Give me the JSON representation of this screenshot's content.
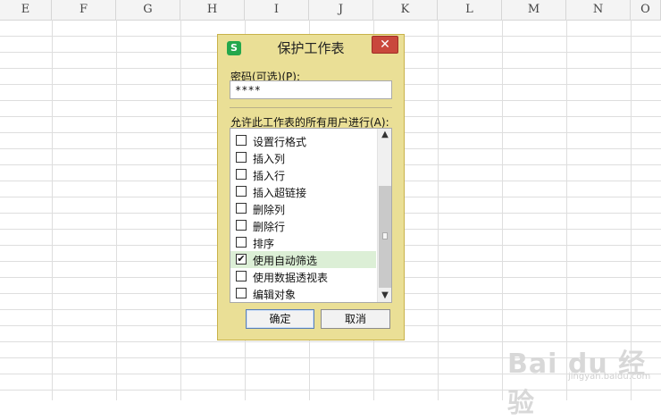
{
  "sheet": {
    "columns": [
      "E",
      "F",
      "G",
      "H",
      "I",
      "J",
      "K",
      "L",
      "M",
      "N",
      "O"
    ]
  },
  "dialog": {
    "title": "保护工作表",
    "app_icon_text": "S",
    "close_symbol": "✕",
    "password_label": "密码(可选)(P):",
    "password_value": "****",
    "allow_label": "允许此工作表的所有用户进行(A):",
    "permissions": [
      {
        "label": "设置行格式",
        "checked": false
      },
      {
        "label": "插入列",
        "checked": false
      },
      {
        "label": "插入行",
        "checked": false
      },
      {
        "label": "插入超链接",
        "checked": false
      },
      {
        "label": "删除列",
        "checked": false
      },
      {
        "label": "删除行",
        "checked": false
      },
      {
        "label": "排序",
        "checked": false
      },
      {
        "label": "使用自动筛选",
        "checked": true
      },
      {
        "label": "使用数据透视表",
        "checked": false
      },
      {
        "label": "编辑对象",
        "checked": false
      }
    ],
    "scroll_up_symbol": "▲",
    "scroll_down_symbol": "▼",
    "ok_label": "确定",
    "cancel_label": "取消"
  },
  "watermark": {
    "text": "Bai du 经验",
    "sub": "jingyan.baidu.com"
  },
  "colors": {
    "dialog_bg": "#eadf96",
    "close_button": "#c9483c",
    "highlight_row": "#dcefd6",
    "app_icon": "#24a74c"
  }
}
